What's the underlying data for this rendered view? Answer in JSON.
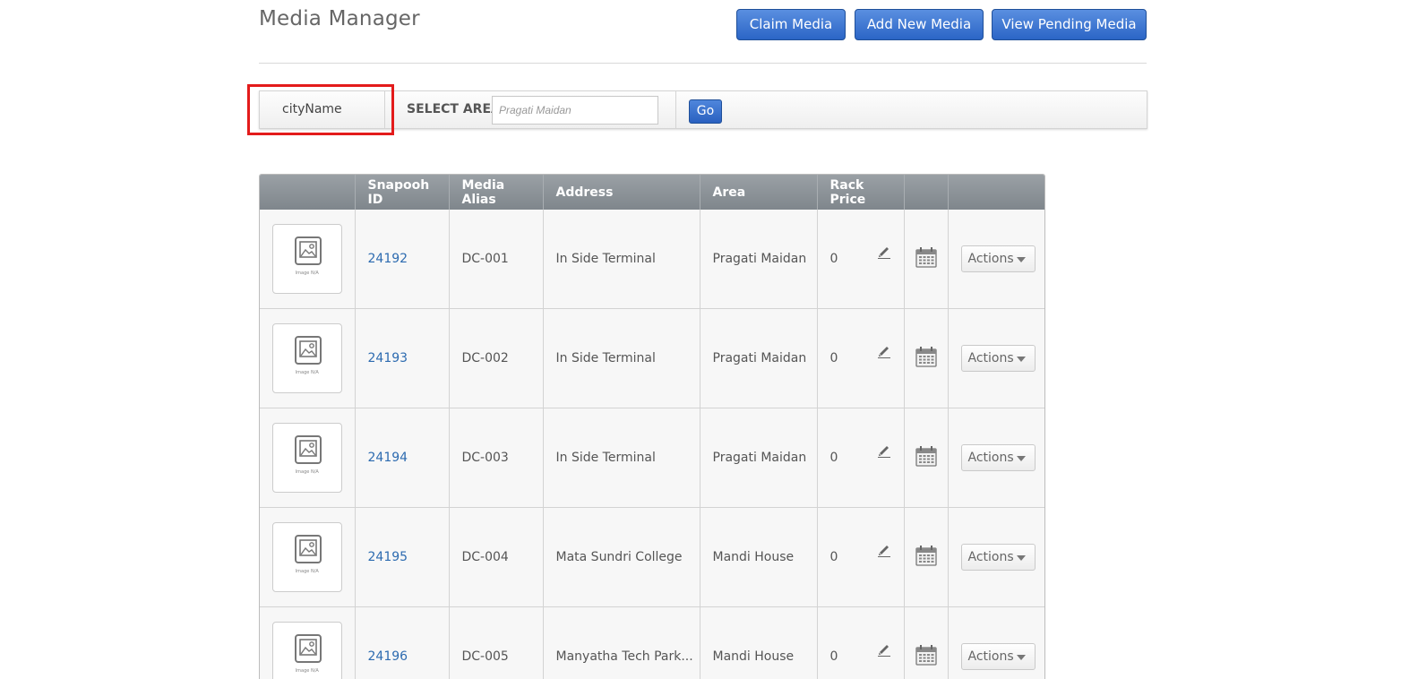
{
  "page": {
    "title": "Media Manager"
  },
  "toolbar": {
    "claim_label": "Claim Media",
    "add_label": "Add New Media",
    "pending_label": "View Pending Media"
  },
  "filter": {
    "city_value": "cityName",
    "select_area_label": "SELECT AREA",
    "area_placeholder": "Pragati Maidan",
    "go_label": "Go"
  },
  "table": {
    "headers": [
      "",
      "Snapooh ID",
      "Media Alias",
      "Address",
      "Area",
      "Rack Price",
      "",
      ""
    ],
    "image_caption": "Image N/A",
    "actions_label": "Actions",
    "rows": [
      {
        "id": "24192",
        "alias": "DC-001",
        "address": "In Side Terminal",
        "area": "Pragati Maidan",
        "price": "0"
      },
      {
        "id": "24193",
        "alias": "DC-002",
        "address": "In Side Terminal",
        "area": "Pragati Maidan",
        "price": "0"
      },
      {
        "id": "24194",
        "alias": "DC-003",
        "address": "In Side Terminal",
        "area": "Pragati Maidan",
        "price": "0"
      },
      {
        "id": "24195",
        "alias": "DC-004",
        "address": "Mata Sundri College",
        "area": "Mandi House",
        "price": "0"
      },
      {
        "id": "24196",
        "alias": "DC-005",
        "address": "Manyatha Tech Park...",
        "area": "Mandi House",
        "price": "0"
      }
    ]
  },
  "colors": {
    "primary_button": "#2b65c6",
    "header_bg": "#868d93",
    "link": "#2d6bb0",
    "highlight": "#e31b1b"
  },
  "icons": {
    "thumbnail": "image-placeholder-icon",
    "edit": "pencil-icon",
    "calendar": "calendar-icon",
    "dropdown": "caret-down-icon"
  }
}
